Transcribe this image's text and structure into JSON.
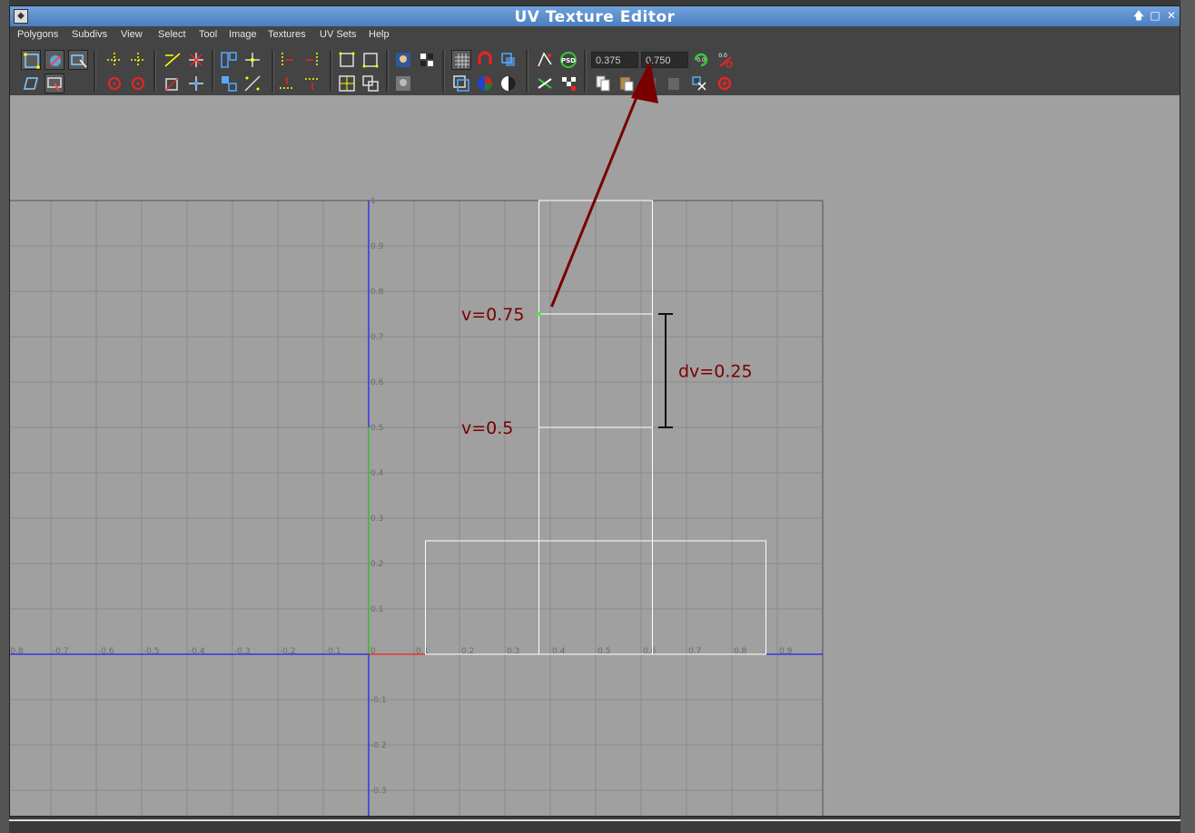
{
  "window": {
    "title": "UV Texture Editor"
  },
  "menu": [
    "Polygons",
    "Subdivs",
    "View",
    "Select",
    "Tool",
    "Image",
    "Textures",
    "UV Sets",
    "Help"
  ],
  "toolbar": {
    "u_value": "0.375",
    "v_value": "0.750"
  },
  "axis": {
    "x_labels": [
      "-0.8",
      "-0.7",
      "-0.6",
      "-0.5",
      "-0.4",
      "-0.3",
      "-0.2",
      "-0.1",
      "0",
      "0.1",
      "0.2",
      "0.3",
      "0.4",
      "0.5",
      "0.6",
      "0.7",
      "0.8",
      "0.9"
    ],
    "y_labels": [
      "1",
      "0.9",
      "0.8",
      "0.7",
      "0.6",
      "0.5",
      "0.4",
      "0.3",
      "0.2",
      "0.1",
      "-0.1",
      "-0.2",
      "-0.3"
    ]
  },
  "annotations": {
    "v_top": "v=0.75",
    "v_bottom": "v=0.5",
    "dv": "dv=0.25",
    "annotation_color": "#7a0000"
  },
  "colors": {
    "u_axis_color": "#0000ff",
    "v_axis_color": "#00cc00",
    "uv_shell_color": "#ffffff",
    "grid_color": "#8a8a8a"
  }
}
